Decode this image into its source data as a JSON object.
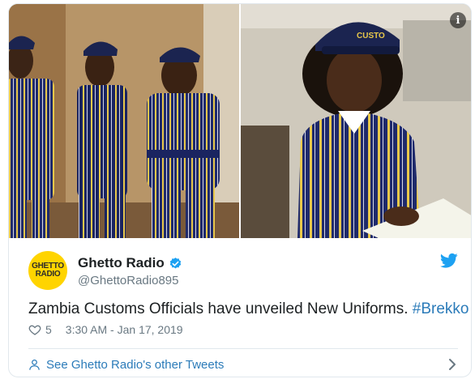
{
  "media": {
    "left_photo": "photo-three-customs-officers",
    "right_photo": "photo-customs-officer-reading",
    "info_icon": "info-icon",
    "info_glyph": "i",
    "cap_text": "CUSTO"
  },
  "account": {
    "avatar_line1": "GHETTO",
    "avatar_line2": "RADIO",
    "name": "Ghetto Radio",
    "handle": "@GhettoRadio895",
    "verified": true
  },
  "tweet": {
    "text": "Zambia Customs Officials have unveiled New Uniforms. ",
    "hashtag": "#Brekko"
  },
  "meta": {
    "likes": "5",
    "timestamp": "3:30 AM - Jan 17, 2019"
  },
  "footer": {
    "link_text": "See Ghetto Radio's other Tweets"
  },
  "colors": {
    "link": "#2b7bb9",
    "muted": "#697882",
    "uniform_navy": "#1f2a6b",
    "stripe_yellow": "#e8c84a",
    "avatar_bg": "#ffd400"
  }
}
